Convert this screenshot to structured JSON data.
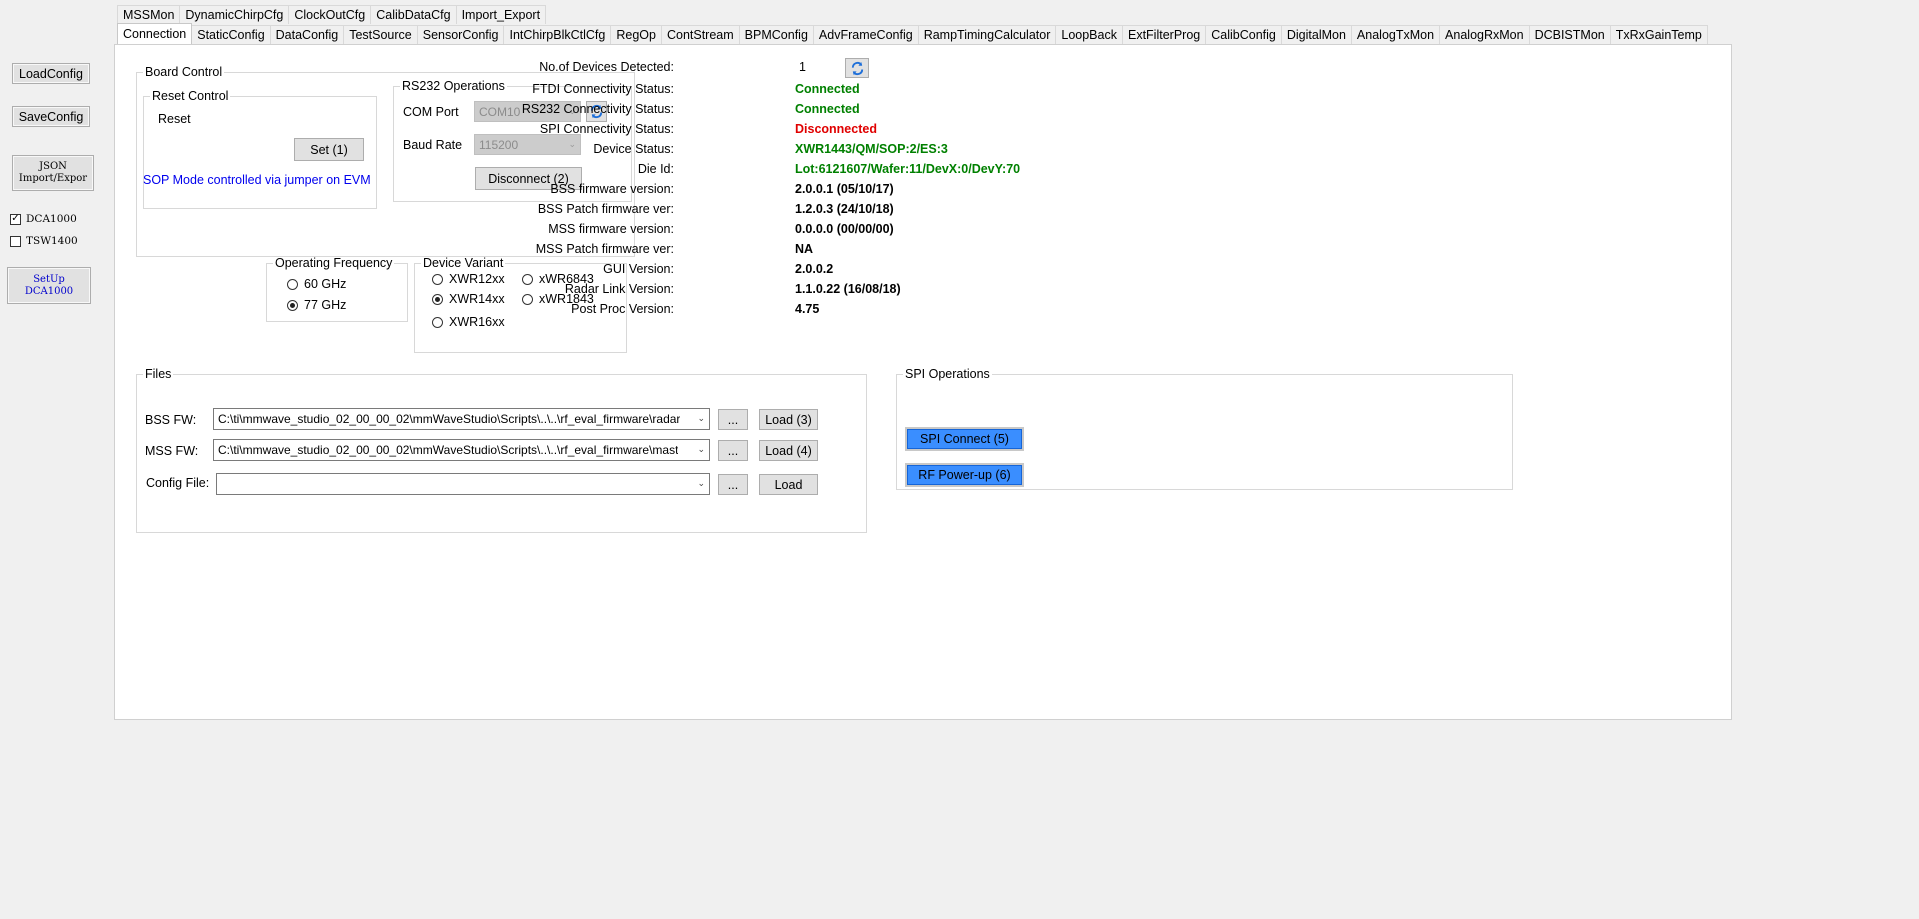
{
  "sidebar": {
    "load_config": "LoadConfig",
    "save_config": "SaveConfig",
    "json_line1": "JSON",
    "json_line2": "Import/Expor",
    "dca1000": "DCA1000",
    "tsw1400": "TSW1400",
    "setup_line1": "SetUp",
    "setup_line2": "DCA1000"
  },
  "tabs_row1": [
    "MSSMon",
    "DynamicChirpCfg",
    "ClockOutCfg",
    "CalibDataCfg",
    "Import_Export"
  ],
  "tabs_row2": [
    "Connection",
    "StaticConfig",
    "DataConfig",
    "TestSource",
    "SensorConfig",
    "IntChirpBlkCtlCfg",
    "RegOp",
    "ContStream",
    "BPMConfig",
    "AdvFrameConfig",
    "RampTimingCalculator",
    "LoopBack",
    "ExtFilterProg",
    "CalibConfig",
    "DigitalMon",
    "AnalogTxMon",
    "AnalogRxMon",
    "DCBISTMon",
    "TxRxGainTemp"
  ],
  "board_control": {
    "title": "Board Control",
    "reset_control": {
      "title": "Reset Control",
      "label": "Reset",
      "set_button": "Set (1)"
    },
    "sop_note": "SOP Mode controlled via jumper on EVM",
    "rs232": {
      "title": "RS232 Operations",
      "com_port_label": "COM Port",
      "com_port_value": "COM10",
      "baud_label": "Baud Rate",
      "baud_value": "115200",
      "disconnect_button": "Disconnect (2)"
    }
  },
  "operating_frequency": {
    "title": "Operating Frequency",
    "options": [
      "60 GHz",
      "77 GHz"
    ],
    "selected": "77 GHz"
  },
  "device_variant": {
    "title": "Device Variant",
    "options": [
      "XWR12xx",
      "xWR6843",
      "XWR14xx",
      "xWR1843",
      "XWR16xx"
    ],
    "selected": "XWR14xx"
  },
  "status": {
    "devices_label": "No.of Devices Detected:",
    "devices_value": "1",
    "ftdi_label": "FTDI Connectivity Status:",
    "ftdi_value": "Connected",
    "rs232_label": "RS232 Connectivity Status:",
    "rs232_value": "Connected",
    "spi_label": "SPI Connectivity Status:",
    "spi_value": "Disconnected",
    "device_status_label": "Device Status:",
    "device_status_value": "XWR1443/QM/SOP:2/ES:3",
    "die_id_label": "Die Id:",
    "die_id_value": "Lot:6121607/Wafer:11/DevX:0/DevY:70",
    "bss_fw_label": "BSS firmware version:",
    "bss_fw_value": "2.0.0.1 (05/10/17)",
    "bss_patch_label": "BSS Patch firmware ver:",
    "bss_patch_value": "1.2.0.3 (24/10/18)",
    "mss_fw_label": "MSS firmware version:",
    "mss_fw_value": "0.0.0.0 (00/00/00)",
    "mss_patch_label": "MSS Patch firmware ver:",
    "mss_patch_value": "NA",
    "gui_label": "GUI Version:",
    "gui_value": "2.0.0.2",
    "radar_label": "Radar Link Version:",
    "radar_value": "1.1.0.22 (16/08/18)",
    "postproc_label": "Post Proc Version:",
    "postproc_value": "4.75"
  },
  "files": {
    "title": "Files",
    "bss_label": "BSS FW:",
    "bss_path": "C:\\ti\\mmwave_studio_02_00_00_02\\mmWaveStudio\\Scripts\\..\\..\\rf_eval_firmware\\radar",
    "bss_load": "Load (3)",
    "mss_label": "MSS FW:",
    "mss_path": "C:\\ti\\mmwave_studio_02_00_00_02\\mmWaveStudio\\Scripts\\..\\..\\rf_eval_firmware\\mast",
    "mss_load": "Load (4)",
    "config_label": "Config File:",
    "config_path": "",
    "config_load": "Load",
    "browse": "..."
  },
  "spi": {
    "title": "SPI Operations",
    "connect_button": "SPI Connect (5)",
    "rf_button": "RF Power-up (6)"
  },
  "colors": {
    "connected": "#008000",
    "disconnected": "#e00000",
    "spi_button": "#3a8eff",
    "sop_note": "#0000ee"
  }
}
